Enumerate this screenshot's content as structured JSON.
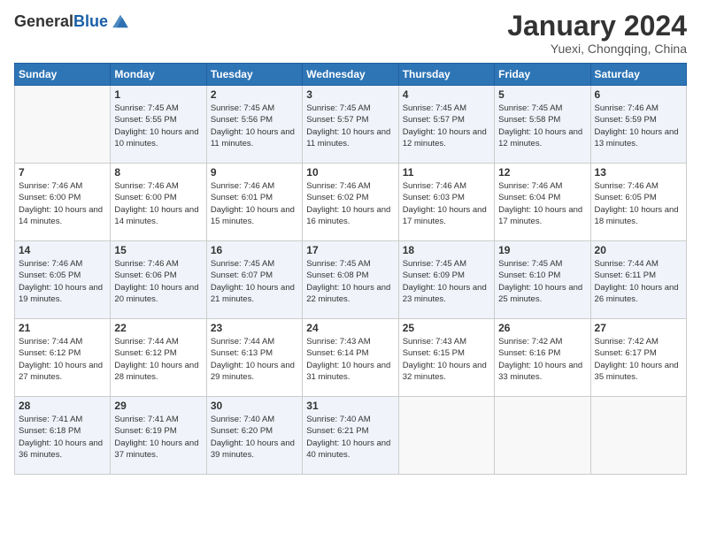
{
  "header": {
    "logo_general": "General",
    "logo_blue": "Blue",
    "month_title": "January 2024",
    "location": "Yuexi, Chongqing, China"
  },
  "weekdays": [
    "Sunday",
    "Monday",
    "Tuesday",
    "Wednesday",
    "Thursday",
    "Friday",
    "Saturday"
  ],
  "weeks": [
    [
      {
        "day": "",
        "empty": true
      },
      {
        "day": "1",
        "sunrise": "7:45 AM",
        "sunset": "5:55 PM",
        "daylight": "10 hours and 10 minutes."
      },
      {
        "day": "2",
        "sunrise": "7:45 AM",
        "sunset": "5:56 PM",
        "daylight": "10 hours and 11 minutes."
      },
      {
        "day": "3",
        "sunrise": "7:45 AM",
        "sunset": "5:57 PM",
        "daylight": "10 hours and 11 minutes."
      },
      {
        "day": "4",
        "sunrise": "7:45 AM",
        "sunset": "5:57 PM",
        "daylight": "10 hours and 12 minutes."
      },
      {
        "day": "5",
        "sunrise": "7:45 AM",
        "sunset": "5:58 PM",
        "daylight": "10 hours and 12 minutes."
      },
      {
        "day": "6",
        "sunrise": "7:46 AM",
        "sunset": "5:59 PM",
        "daylight": "10 hours and 13 minutes."
      }
    ],
    [
      {
        "day": "7",
        "sunrise": "7:46 AM",
        "sunset": "6:00 PM",
        "daylight": "10 hours and 14 minutes."
      },
      {
        "day": "8",
        "sunrise": "7:46 AM",
        "sunset": "6:00 PM",
        "daylight": "10 hours and 14 minutes."
      },
      {
        "day": "9",
        "sunrise": "7:46 AM",
        "sunset": "6:01 PM",
        "daylight": "10 hours and 15 minutes."
      },
      {
        "day": "10",
        "sunrise": "7:46 AM",
        "sunset": "6:02 PM",
        "daylight": "10 hours and 16 minutes."
      },
      {
        "day": "11",
        "sunrise": "7:46 AM",
        "sunset": "6:03 PM",
        "daylight": "10 hours and 17 minutes."
      },
      {
        "day": "12",
        "sunrise": "7:46 AM",
        "sunset": "6:04 PM",
        "daylight": "10 hours and 17 minutes."
      },
      {
        "day": "13",
        "sunrise": "7:46 AM",
        "sunset": "6:05 PM",
        "daylight": "10 hours and 18 minutes."
      }
    ],
    [
      {
        "day": "14",
        "sunrise": "7:46 AM",
        "sunset": "6:05 PM",
        "daylight": "10 hours and 19 minutes."
      },
      {
        "day": "15",
        "sunrise": "7:46 AM",
        "sunset": "6:06 PM",
        "daylight": "10 hours and 20 minutes."
      },
      {
        "day": "16",
        "sunrise": "7:45 AM",
        "sunset": "6:07 PM",
        "daylight": "10 hours and 21 minutes."
      },
      {
        "day": "17",
        "sunrise": "7:45 AM",
        "sunset": "6:08 PM",
        "daylight": "10 hours and 22 minutes."
      },
      {
        "day": "18",
        "sunrise": "7:45 AM",
        "sunset": "6:09 PM",
        "daylight": "10 hours and 23 minutes."
      },
      {
        "day": "19",
        "sunrise": "7:45 AM",
        "sunset": "6:10 PM",
        "daylight": "10 hours and 25 minutes."
      },
      {
        "day": "20",
        "sunrise": "7:44 AM",
        "sunset": "6:11 PM",
        "daylight": "10 hours and 26 minutes."
      }
    ],
    [
      {
        "day": "21",
        "sunrise": "7:44 AM",
        "sunset": "6:12 PM",
        "daylight": "10 hours and 27 minutes."
      },
      {
        "day": "22",
        "sunrise": "7:44 AM",
        "sunset": "6:12 PM",
        "daylight": "10 hours and 28 minutes."
      },
      {
        "day": "23",
        "sunrise": "7:44 AM",
        "sunset": "6:13 PM",
        "daylight": "10 hours and 29 minutes."
      },
      {
        "day": "24",
        "sunrise": "7:43 AM",
        "sunset": "6:14 PM",
        "daylight": "10 hours and 31 minutes."
      },
      {
        "day": "25",
        "sunrise": "7:43 AM",
        "sunset": "6:15 PM",
        "daylight": "10 hours and 32 minutes."
      },
      {
        "day": "26",
        "sunrise": "7:42 AM",
        "sunset": "6:16 PM",
        "daylight": "10 hours and 33 minutes."
      },
      {
        "day": "27",
        "sunrise": "7:42 AM",
        "sunset": "6:17 PM",
        "daylight": "10 hours and 35 minutes."
      }
    ],
    [
      {
        "day": "28",
        "sunrise": "7:41 AM",
        "sunset": "6:18 PM",
        "daylight": "10 hours and 36 minutes."
      },
      {
        "day": "29",
        "sunrise": "7:41 AM",
        "sunset": "6:19 PM",
        "daylight": "10 hours and 37 minutes."
      },
      {
        "day": "30",
        "sunrise": "7:40 AM",
        "sunset": "6:20 PM",
        "daylight": "10 hours and 39 minutes."
      },
      {
        "day": "31",
        "sunrise": "7:40 AM",
        "sunset": "6:21 PM",
        "daylight": "10 hours and 40 minutes."
      },
      {
        "day": "",
        "empty": true
      },
      {
        "day": "",
        "empty": true
      },
      {
        "day": "",
        "empty": true
      }
    ]
  ]
}
